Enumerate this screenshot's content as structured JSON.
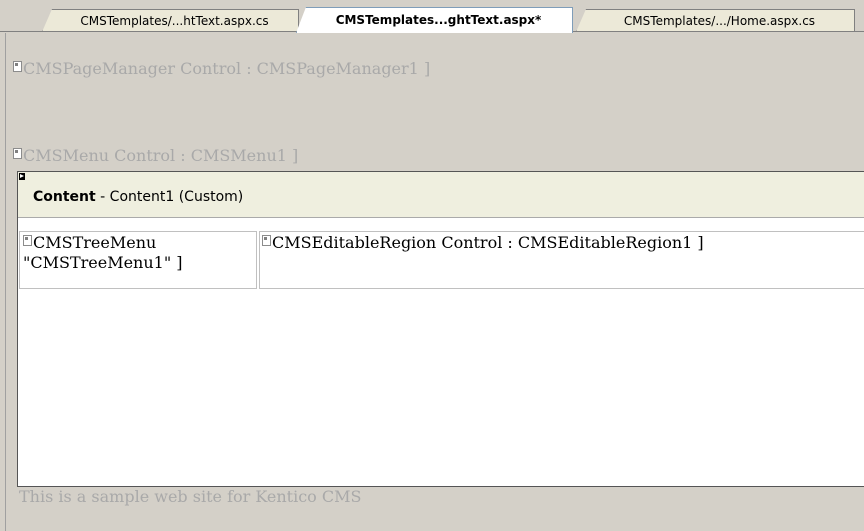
{
  "tabs": [
    {
      "label": "CMSTemplates/...htText.aspx.cs",
      "active": false
    },
    {
      "label": "CMSTemplates...ghtText.aspx*",
      "active": true
    },
    {
      "label": "CMSTemplates/.../Home.aspx.cs",
      "active": false
    }
  ],
  "designer": {
    "page_manager": "CMSPageManager Control : CMSPageManager1 ]",
    "menu": "CMSMenu Control : CMSMenu1 ]",
    "content": {
      "title_bold": "Content",
      "title_rest": " - Content1 (Custom)",
      "tree_menu_line1": "CMSTreeMenu",
      "tree_menu_line2": "\"CMSTreeMenu1\" ]",
      "editable_region": "CMSEditableRegion Control : CMSEditableRegion1 ]"
    },
    "footer": "This is a sample web site for Kentico CMS"
  },
  "colors": {
    "background": "#d4d0c8",
    "placeholder_text": "#a9a9a9",
    "content_header": "#efefdf"
  }
}
